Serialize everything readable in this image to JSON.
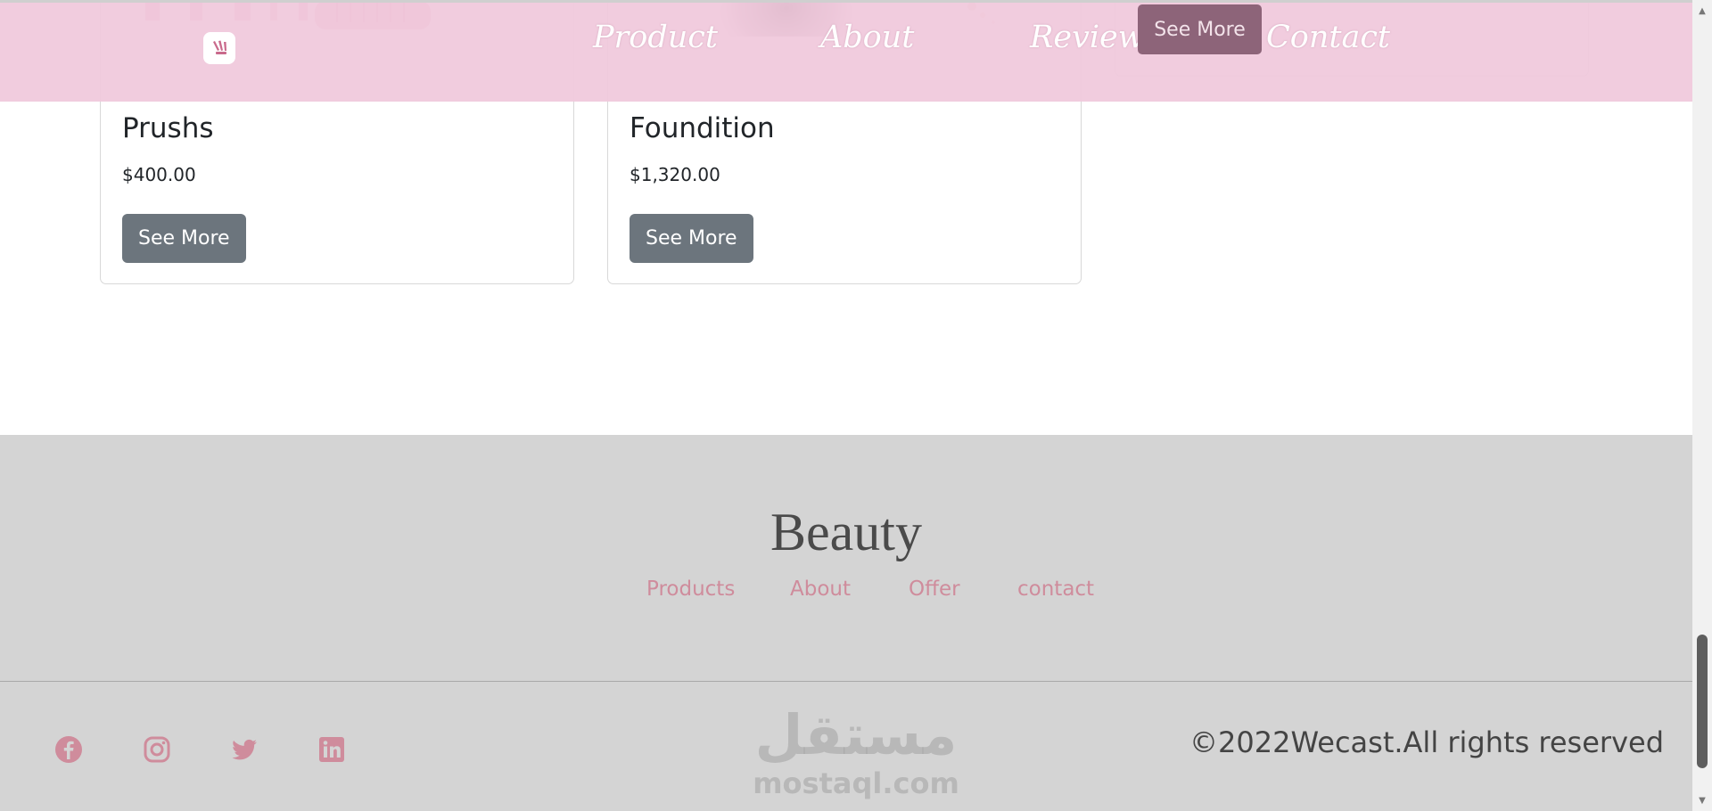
{
  "navbar": {
    "logo_icon": "brush-logo-icon",
    "links": [
      "Product",
      "About",
      "Reviews",
      "Contact"
    ],
    "see_more_label": "See More",
    "background": "#f0c8db"
  },
  "products": [
    {
      "name": "Prushs",
      "price": "$400.00",
      "button": "See More"
    },
    {
      "name": "Foundition",
      "price": "$1,320.00",
      "button": "See More"
    }
  ],
  "footer": {
    "brand": "Beauty",
    "links": [
      "Products",
      "About",
      "Offer",
      "contact"
    ],
    "social_icons": [
      "facebook-icon",
      "instagram-icon",
      "twitter-icon",
      "linkedin-icon"
    ],
    "copyright": "©2022Wecast.All rights reserved",
    "watermark_arabic": "مستقل",
    "watermark_latin": "mostaql.com",
    "link_color": "#cf8c9c",
    "background": "#d4d4d4"
  },
  "colors": {
    "button_gray": "#6c757d",
    "nav_button": "#8d6479"
  }
}
